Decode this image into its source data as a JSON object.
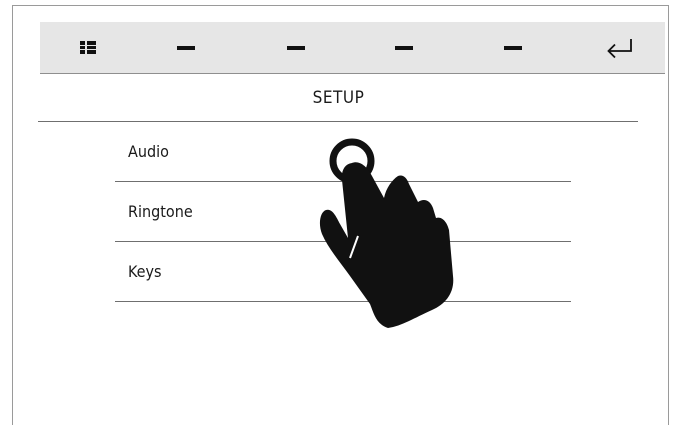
{
  "toolbar": {
    "items": [
      {
        "icon": "grid-icon"
      },
      {
        "icon": "dash-icon"
      },
      {
        "icon": "dash-icon"
      },
      {
        "icon": "dash-icon"
      },
      {
        "icon": "dash-icon"
      },
      {
        "icon": "return-icon"
      }
    ],
    "background": "#e6e6e6"
  },
  "screen": {
    "title": "SETUP"
  },
  "menu": {
    "items": [
      {
        "label": "Audio"
      },
      {
        "label": "Ringtone"
      },
      {
        "label": "Keys"
      }
    ]
  },
  "overlay": {
    "icon": "tap-gesture-hand-icon"
  }
}
